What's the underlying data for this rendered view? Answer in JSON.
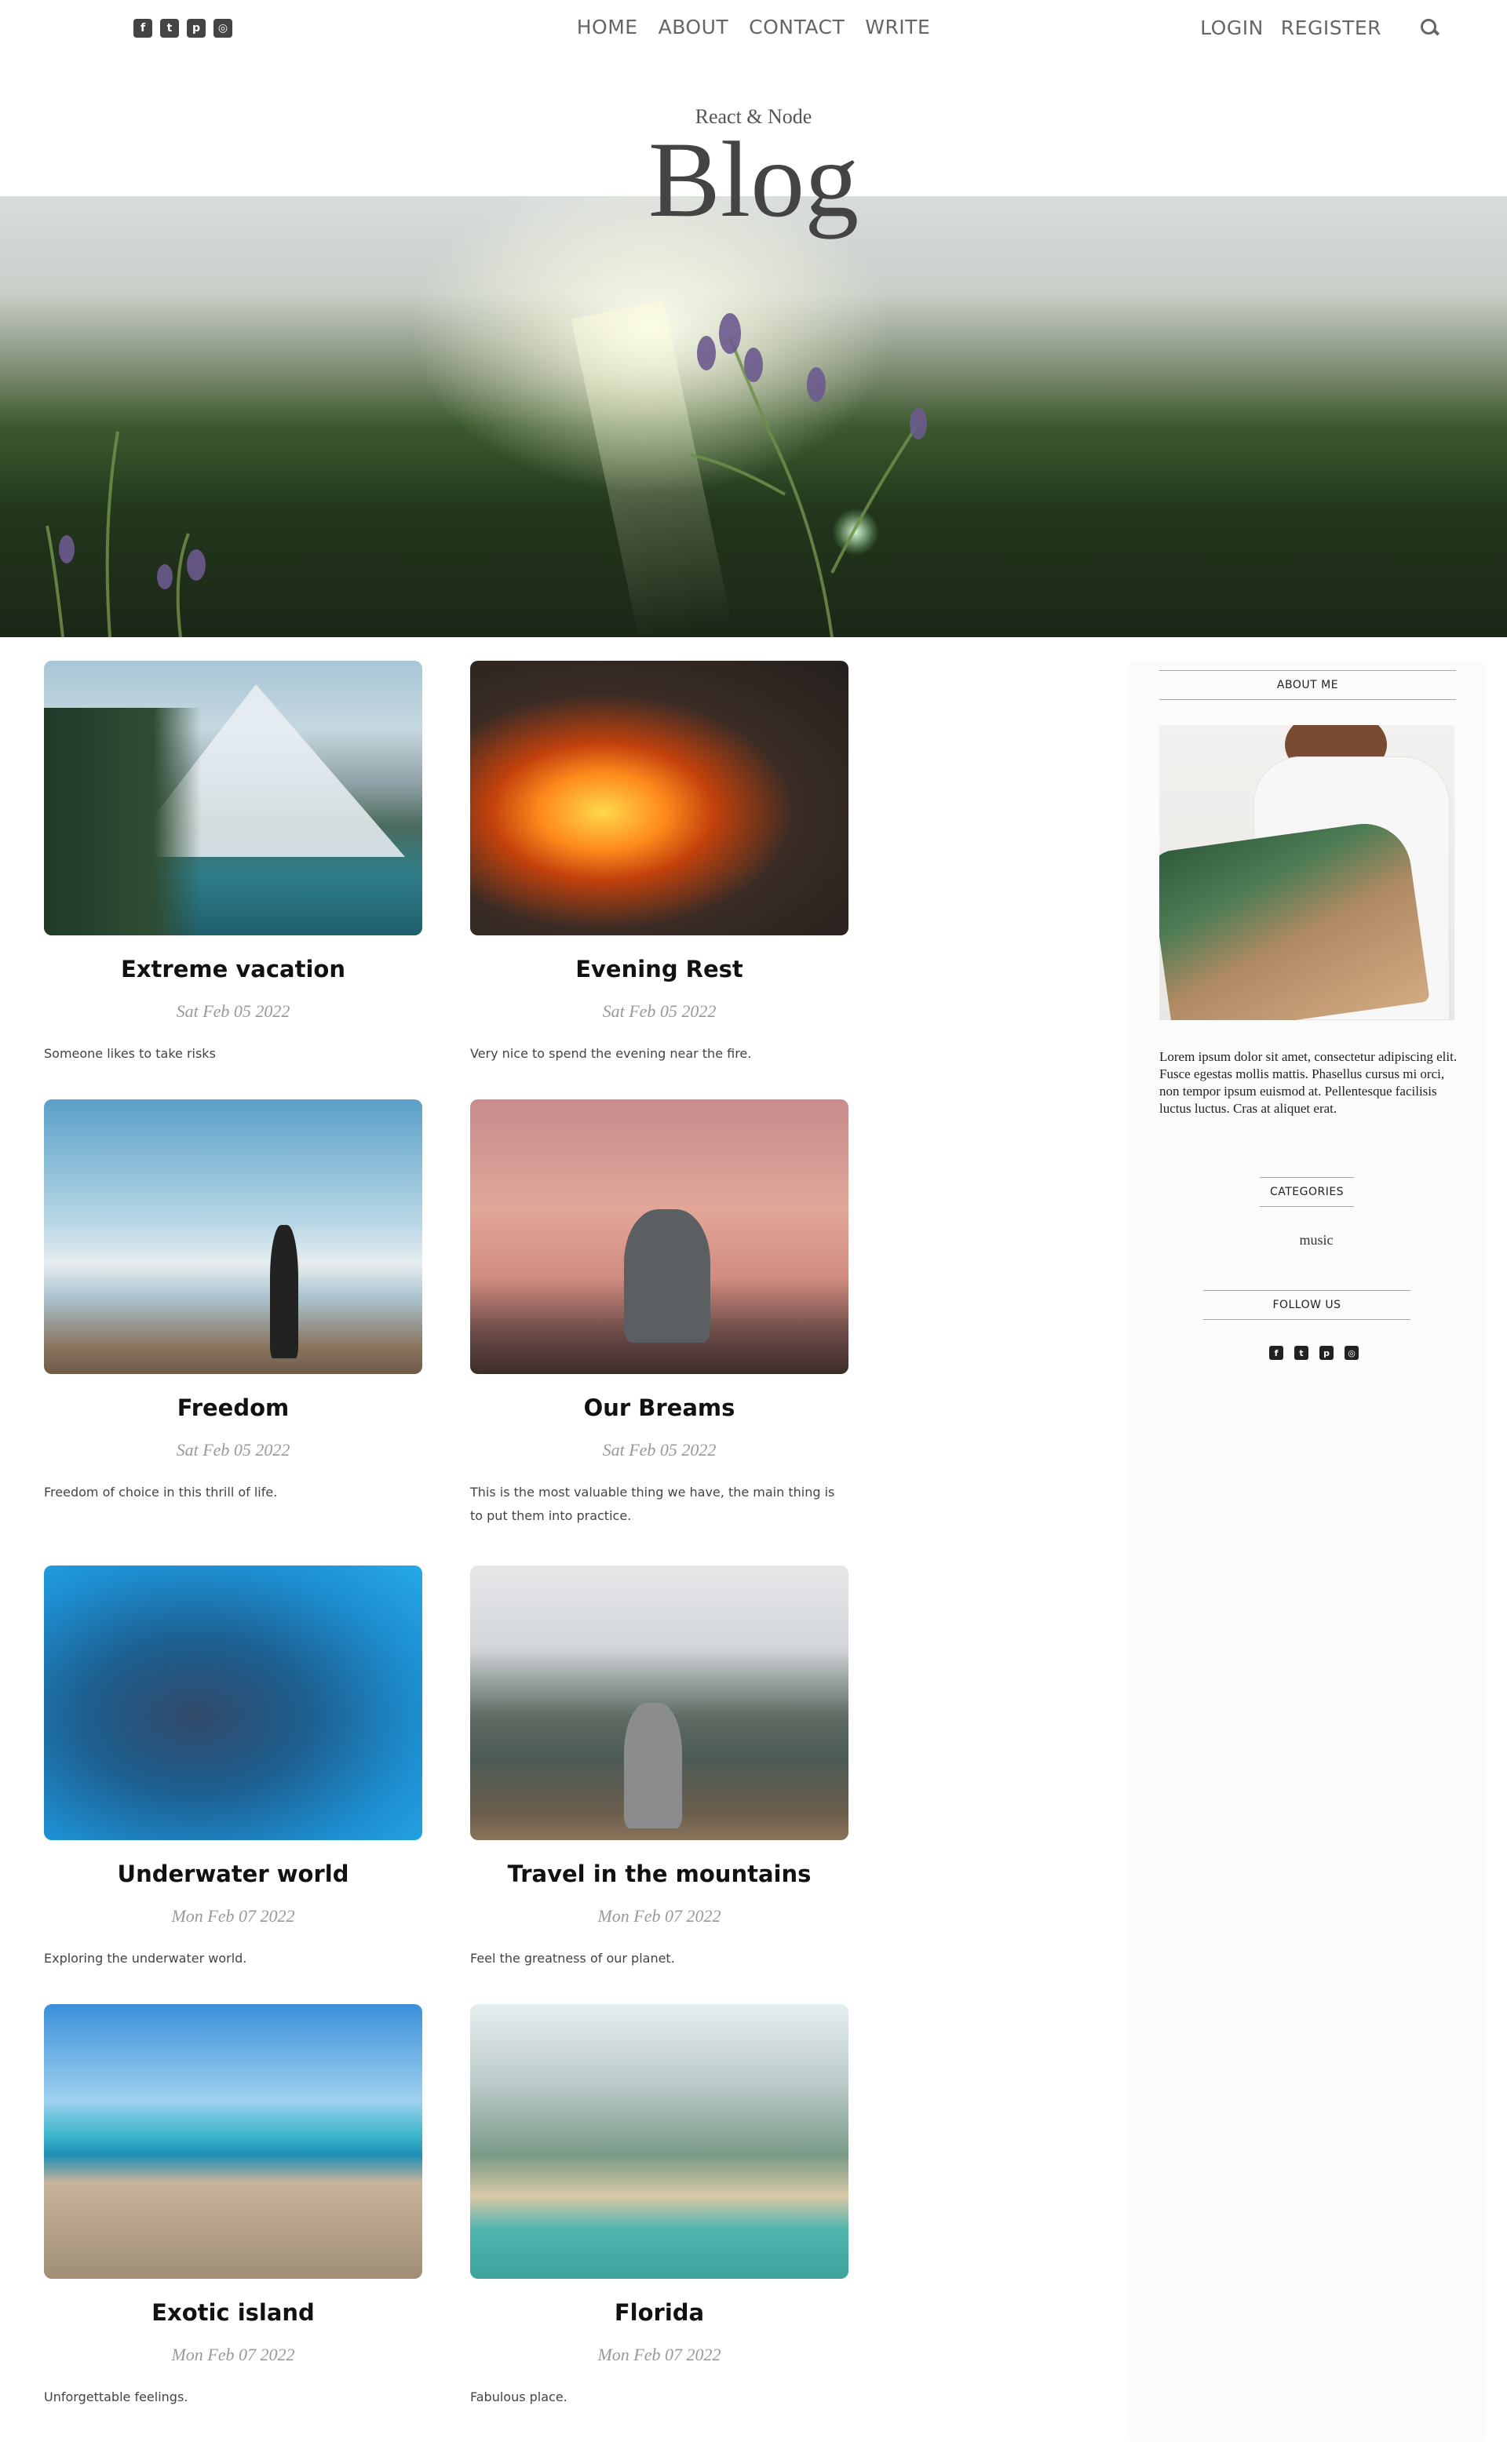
{
  "topbar": {
    "social": [
      "facebook-square-icon",
      "twitter-square-icon",
      "pinterest-square-icon",
      "instagram-square-icon"
    ],
    "menu": [
      "HOME",
      "ABOUT",
      "CONTACT",
      "WRITE"
    ],
    "auth": [
      "LOGIN",
      "REGISTER"
    ]
  },
  "header": {
    "subtitle": "React & Node",
    "title": "Blog"
  },
  "posts": [
    {
      "title": "Extreme vacation",
      "date": "Sat Feb 05 2022",
      "desc": "Someone likes to take risks"
    },
    {
      "title": "Evening Rest",
      "date": "Sat Feb 05 2022",
      "desc": "Very nice to spend the evening near the fire."
    },
    {
      "title": "Freedom",
      "date": "Sat Feb 05 2022",
      "desc": "Freedom of choice in this thrill of life."
    },
    {
      "title": "Our Breams",
      "date": "Sat Feb 05 2022",
      "desc": "This is the most valuable thing we have, the main thing is to put them into practice."
    },
    {
      "title": "Underwater world",
      "date": "Mon Feb 07 2022",
      "desc": "Exploring the underwater world."
    },
    {
      "title": "Travel in the mountains",
      "date": "Mon Feb 07 2022",
      "desc": "Feel the greatness of our planet."
    },
    {
      "title": "Exotic island",
      "date": "Mon Feb 07 2022",
      "desc": "Unforgettable feelings."
    },
    {
      "title": "Florida",
      "date": "Mon Feb 07 2022",
      "desc": "Fabulous place."
    }
  ],
  "sidebar": {
    "about_title": "ABOUT ME",
    "about_text": "Lorem ipsum dolor sit amet, consectetur adipiscing elit. Fusce egestas mollis mattis. Phasellus cursus mi orci, non tempor ipsum euismod at. Pellentesque facilisis luctus luctus. Cras at aliquet erat.",
    "categories_title": "CATEGORIES",
    "categories": [
      "music"
    ],
    "follow_title": "FOLLOW US"
  }
}
